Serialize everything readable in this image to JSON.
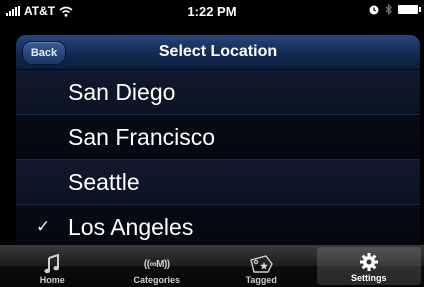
{
  "status_bar": {
    "carrier": "AT&T",
    "time": "1:22 PM"
  },
  "nav": {
    "back_label": "Back",
    "title": "Select Location"
  },
  "locations": [
    {
      "label": "San Diego",
      "checked": false
    },
    {
      "label": "San Francisco",
      "checked": false
    },
    {
      "label": "Seattle",
      "checked": false
    },
    {
      "label": "Los Angeles",
      "checked": true
    }
  ],
  "check_mark": "✓",
  "tabs": [
    {
      "label": "Home",
      "icon": "music-note-icon",
      "selected": false
    },
    {
      "label": "Categories",
      "icon": "xm-logo-icon",
      "icon_text": "((∞M))",
      "selected": false
    },
    {
      "label": "Tagged",
      "icon": "tag-star-icon",
      "selected": false
    },
    {
      "label": "Settings",
      "icon": "gear-icon",
      "selected": true
    }
  ]
}
